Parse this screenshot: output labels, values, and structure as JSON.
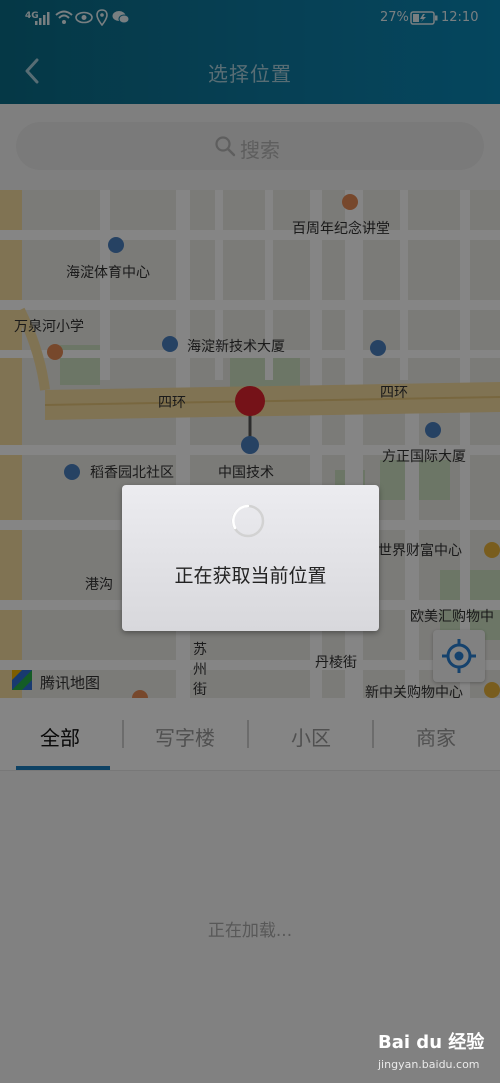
{
  "status_bar": {
    "network": "4G",
    "battery": "27%",
    "time": "12:10"
  },
  "header": {
    "title": "选择位置",
    "back_icon": "back-chevron-icon"
  },
  "search": {
    "placeholder": "搜索",
    "icon": "search-icon"
  },
  "map": {
    "labels": [
      "百周年纪念讲堂",
      "海淀体育中心",
      "万泉河小学",
      "海淀新技术大厦",
      "四环",
      "四环",
      "方正国际大厦",
      "稻香园北社区",
      "中国技术",
      "世界财富中心",
      "港沟",
      "欧美汇购物中",
      "苏州街",
      "丹棱街",
      "新中关购物中心",
      "腾讯地图"
    ],
    "locate_icon": "locate-icon",
    "pin_icon": "map-pin-icon",
    "provider_logo": "tencent-map-logo"
  },
  "dialog": {
    "message": "正在获取当前位置"
  },
  "tabs": [
    {
      "label": "全部",
      "active": true
    },
    {
      "label": "写字楼",
      "active": false
    },
    {
      "label": "小区",
      "active": false
    },
    {
      "label": "商家",
      "active": false
    }
  ],
  "list": {
    "loading_text": "正在加载..."
  },
  "watermark": {
    "brand": "Bai du 经验",
    "url": "jingyan.baidu.com"
  },
  "colors": {
    "header": "#0c7aa0",
    "pin": "#e0232e",
    "tab_accent": "#1c7fc0",
    "overlay": "rgba(0,0,0,0.48)"
  }
}
